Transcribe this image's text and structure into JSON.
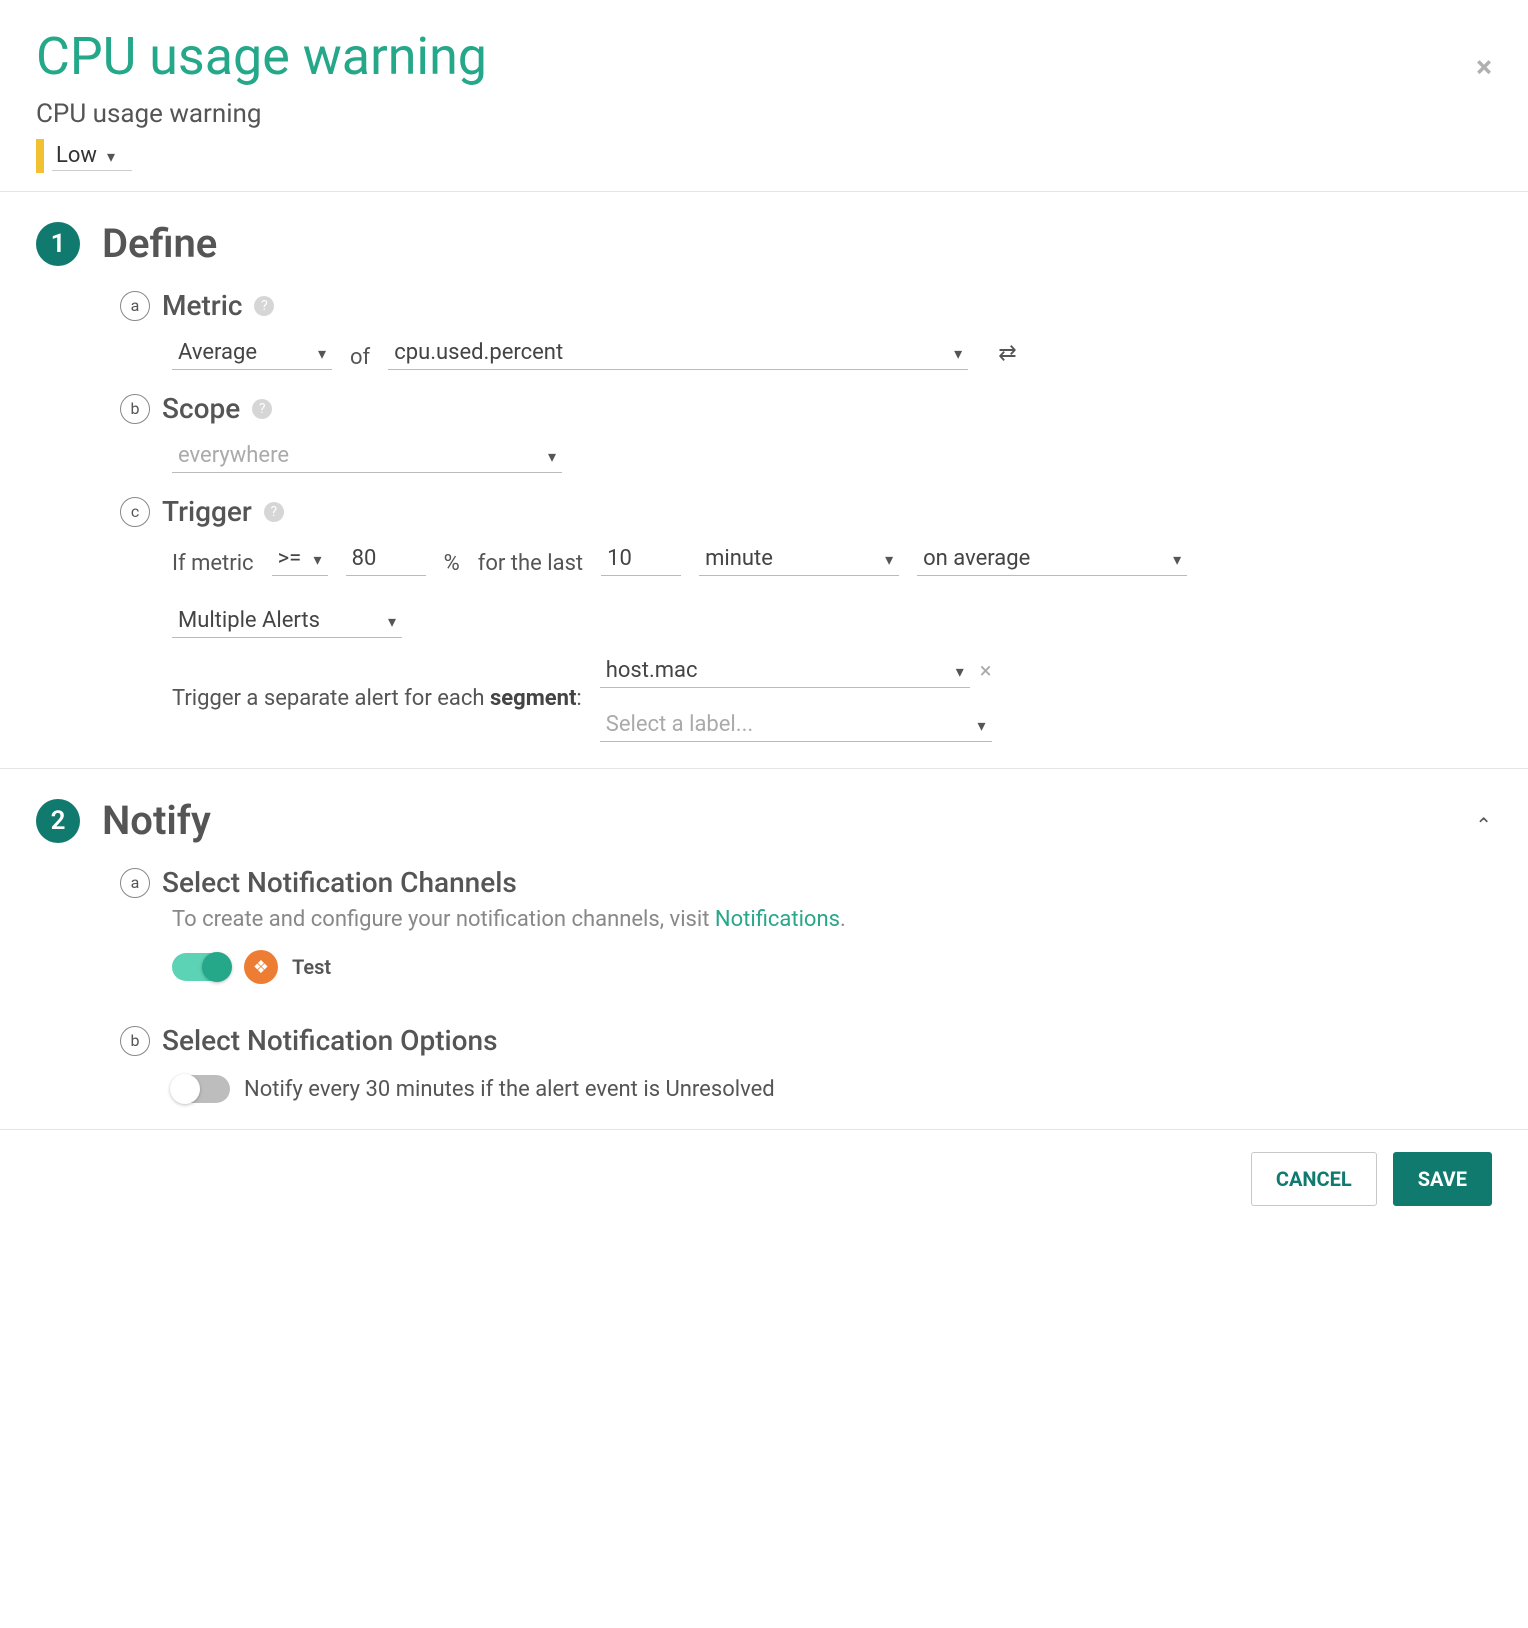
{
  "header": {
    "title": "CPU usage warning",
    "subtitle": "CPU usage warning",
    "severity": "Low"
  },
  "sections": {
    "define": {
      "step": "1",
      "title": "Define",
      "metric": {
        "letter": "a",
        "label": "Metric",
        "agg": "Average",
        "of": "of",
        "metric_name": "cpu.used.percent"
      },
      "scope": {
        "letter": "b",
        "label": "Scope",
        "value_placeholder": "everywhere"
      },
      "trigger": {
        "letter": "c",
        "label": "Trigger",
        "if_metric": "If metric",
        "op": ">=",
        "threshold": "80",
        "pct": "%",
        "for_the_last": "for the last",
        "duration": "10",
        "unit": "minute",
        "mode": "on average",
        "multi_label": "Multiple Alerts",
        "segment_pre": "Trigger a separate alert for each ",
        "segment_strong": "segment",
        "segment_post": ":",
        "segment_value": "host.mac",
        "segment_placeholder": "Select a label..."
      }
    },
    "notify": {
      "step": "2",
      "title": "Notify",
      "channels": {
        "letter": "a",
        "label": "Select Notification Channels",
        "desc_pre": "To create and configure your notification channels, visit ",
        "desc_link": "Notifications",
        "desc_post": ".",
        "test_label": "Test"
      },
      "options": {
        "letter": "b",
        "label": "Select Notification Options",
        "opt_text": "Notify every 30 minutes if the alert event is Unresolved"
      }
    }
  },
  "footer": {
    "cancel": "CANCEL",
    "save": "SAVE"
  }
}
